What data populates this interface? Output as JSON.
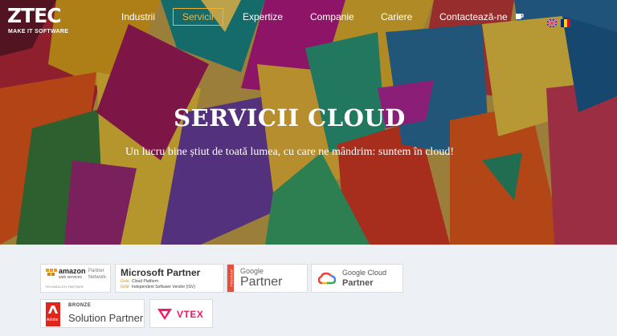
{
  "brand": {
    "mark": "ZTEC",
    "tagline": "MAKE IT SOFTWARE"
  },
  "nav": {
    "items": [
      {
        "label": "Industrii"
      },
      {
        "label": "Servicii"
      },
      {
        "label": "Expertize"
      },
      {
        "label": "Companie"
      },
      {
        "label": "Cariere"
      },
      {
        "label": "Contactează-ne"
      }
    ],
    "active": "Servicii",
    "cup_icon": "coffee-cup-icon",
    "languages": [
      "flag-uk-icon",
      "flag-romania-icon"
    ]
  },
  "hero": {
    "title": "SERVICII CLOUD",
    "subtitle": "Un lucru bine știut de toată lumea, cu care ne mândrim: suntem în cloud!"
  },
  "partners": [
    {
      "name": "amazon",
      "line1": "web services",
      "line2": "Partner",
      "line3": "Network",
      "line4": "TECHNOLOGY PARTNER"
    },
    {
      "name": "Microsoft Partner",
      "line1": "Gold",
      "line2": "Cloud Platform",
      "line3": "Gold",
      "line4": "Independent Software Vendor (ISV)"
    },
    {
      "name": "Google",
      "line1": "Partner",
      "line2": "PREMIER"
    },
    {
      "name": "Google Cloud",
      "line1": "Partner"
    },
    {
      "name": "Adobe",
      "line1": "BRONZE",
      "line2": "Solution Partner"
    },
    {
      "name": "VTEX"
    }
  ],
  "colors": {
    "accent": "#f6b63d",
    "hero_overlay": "#000000",
    "page_bg": "#edf1f5"
  }
}
